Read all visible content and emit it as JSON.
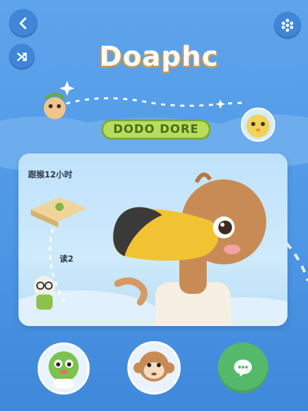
{
  "app": {
    "logo_text": "Doaphc"
  },
  "header": {
    "back_icon": "chevron-left-icon",
    "shuffle_icon": "shuffle-icon",
    "menu_icon": "dots-grid-icon"
  },
  "badge": {
    "title": "DODO DORE"
  },
  "card": {
    "label_top": "跟猴12小时",
    "label_mid": "读2"
  },
  "bottom_nav": {
    "items": [
      {
        "name": "green-turtle-avatar"
      },
      {
        "name": "monkey-avatar"
      },
      {
        "name": "chat-button",
        "icon": "chat-bubble-icon"
      }
    ]
  },
  "colors": {
    "background": "#4f98e6",
    "button": "#3f86d8",
    "badge": "#b8dc5c",
    "chat": "#55b96a"
  }
}
